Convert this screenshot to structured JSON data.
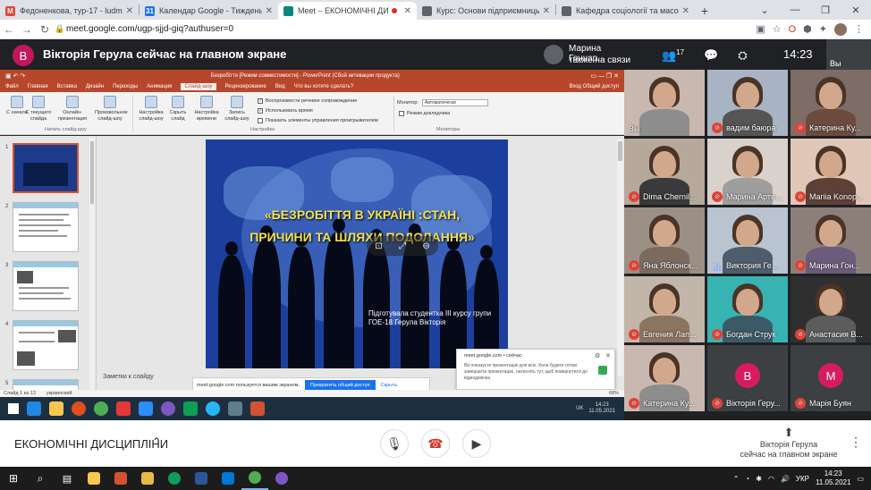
{
  "browser": {
    "tabs": [
      {
        "label": "Федоненкова, тур-17 - ludmilat",
        "favicon": "M",
        "color": "#ea4335"
      },
      {
        "label": "Календар Google - Тиждень (10",
        "favicon": "31",
        "color": "#1a73e8"
      },
      {
        "label": "Meet – ЕКОНОМІЧНІ ДИСЦ",
        "favicon": "",
        "color": "#00897b"
      },
      {
        "label": "Курс: Основи підприємницької",
        "favicon": "",
        "color": "#5f6368"
      },
      {
        "label": "Кафедра соціології та масових",
        "favicon": "",
        "color": "#5f6368"
      }
    ],
    "url": "meet.google.com/ugp-sjjd-giq?authuser=0"
  },
  "meet": {
    "presenter_initial": "В",
    "presenting_label": "Вікторія Герула сейчас на главном экране",
    "pinned_name": "Марина Гончар...",
    "pinned_status": "также на связи",
    "people_count": "17",
    "time": "14:23",
    "self_label": "Вы",
    "meeting_name": "ЕКОНОМІЧНІ ДИСЦИПЛІНИ",
    "present_line1": "Вікторія Герула",
    "present_line2": "сейчас на главном экране"
  },
  "ppt": {
    "window_title": "Безробіття [Режим совместимости] - PowerPoint (Сбой активации продукта)",
    "ribbon_tabs": [
      "Файл",
      "Главная",
      "Вставка",
      "Дизайн",
      "Переходы",
      "Анимация",
      "Слайд-шоу",
      "Рецензирование",
      "Вид",
      "Что вы хотите сделать?"
    ],
    "ribbon_right": "Вход  Общий доступ",
    "buttons": [
      "С начала",
      "С текущего слайда",
      "Онлайн-презентация",
      "Произвольное слайд-шоу",
      "Настройка слайд-шоу",
      "Скрыть слайд",
      "Настройка времени",
      "Запись слайд-шоу"
    ],
    "checks": [
      "Воспроизвести речевое сопровождение",
      "Использовать время",
      "Показать элементы управления проигрывателем"
    ],
    "monitor_label": "Монитор:",
    "monitor_value": "Автоматически",
    "presenter_view": "Режим докладчика",
    "groups": [
      "Начать слайд-шоу",
      "Настройка",
      "Мониторы"
    ],
    "thumb_numbers": [
      "1",
      "2",
      "3",
      "4",
      "5"
    ],
    "slide_title": "«БЕЗРОБІТТЯ В УКРАЇНІ :СТАН, ПРИЧИНИ ТА ШЛЯХИ ПОДОЛАННЯ»",
    "slide_author": "Підготувала студентка  III курсу групи ГОЕ-18 Герула Вікторія",
    "notes": "Заметки к слайду",
    "status_left": "Слайд 1 из 13",
    "status_lang": "украинский",
    "share_text": "meet.google.com пользуется вашим экраном.",
    "share_button": "Прекратить общий доступ",
    "share_hide": "Скрыть",
    "notif_header": "meet.google.com  •  сейчас",
    "notif_body": "Ви показуєте презентацію для всіх. Коли будете готові завершити презентацію, натисніть тут, щоб повернутися до відеодзвінка.",
    "remote_lang": "UK",
    "remote_time": "14:23",
    "remote_date": "11.05.2021",
    "zoom": "68%"
  },
  "participants": [
    {
      "name": "Вы",
      "mic": "none",
      "type": "video"
    },
    {
      "name": "вадим баюра",
      "mic": "off",
      "type": "video"
    },
    {
      "name": "Катерина Ку...",
      "mic": "off",
      "type": "video"
    },
    {
      "name": "Dima Chernil...",
      "mic": "off",
      "type": "video"
    },
    {
      "name": "Марина Арте...",
      "mic": "off",
      "type": "video"
    },
    {
      "name": "Mariia Konop...",
      "mic": "off",
      "type": "video"
    },
    {
      "name": "Яна Яблонск...",
      "mic": "off",
      "type": "video"
    },
    {
      "name": "Виктория Ге...",
      "mic": "on",
      "type": "video"
    },
    {
      "name": "Марина Гон...",
      "mic": "off",
      "type": "video"
    },
    {
      "name": "Евгения Лап...",
      "mic": "off",
      "type": "video"
    },
    {
      "name": "Богдан Струк",
      "mic": "off",
      "type": "video"
    },
    {
      "name": "Анастасия В...",
      "mic": "off",
      "type": "video"
    },
    {
      "name": "Катерина Ку...",
      "mic": "off",
      "type": "video"
    },
    {
      "name": "Вікторія Геру...",
      "mic": "off",
      "type": "avatar",
      "initial": "В",
      "color": "#d81b60"
    },
    {
      "name": "Марія Буян",
      "mic": "off",
      "type": "avatar",
      "initial": "М",
      "color": "#d81b60"
    }
  ],
  "taskbar": {
    "lang": "УКР",
    "time": "14:23",
    "date": "11.05.2021"
  },
  "colors": {
    "ppt_accent": "#b7472a",
    "meet_bg": "#202124",
    "mic_off": "#ea4335",
    "link": "#1a73e8"
  }
}
